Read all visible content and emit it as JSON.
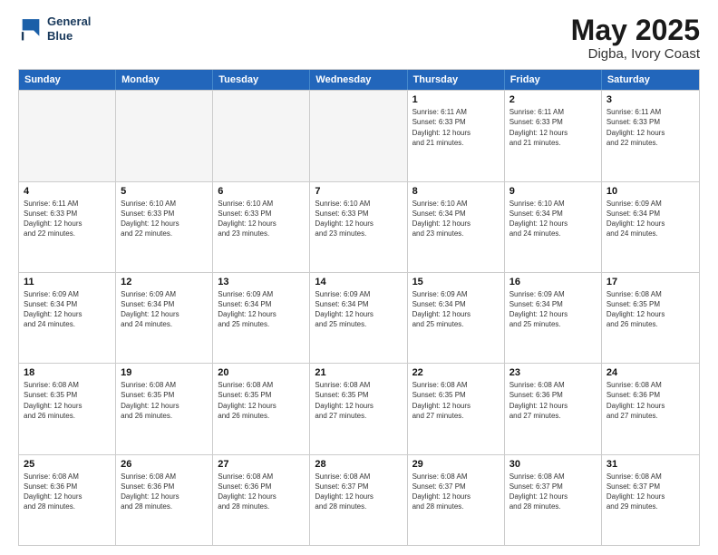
{
  "logo": {
    "line1": "General",
    "line2": "Blue"
  },
  "title": "May 2025",
  "location": "Digba, Ivory Coast",
  "days_of_week": [
    "Sunday",
    "Monday",
    "Tuesday",
    "Wednesday",
    "Thursday",
    "Friday",
    "Saturday"
  ],
  "weeks": [
    [
      {
        "day": "",
        "empty": true
      },
      {
        "day": "",
        "empty": true
      },
      {
        "day": "",
        "empty": true
      },
      {
        "day": "",
        "empty": true
      },
      {
        "day": "1",
        "info": "Sunrise: 6:11 AM\nSunset: 6:33 PM\nDaylight: 12 hours\nand 21 minutes."
      },
      {
        "day": "2",
        "info": "Sunrise: 6:11 AM\nSunset: 6:33 PM\nDaylight: 12 hours\nand 21 minutes."
      },
      {
        "day": "3",
        "info": "Sunrise: 6:11 AM\nSunset: 6:33 PM\nDaylight: 12 hours\nand 22 minutes."
      }
    ],
    [
      {
        "day": "4",
        "info": "Sunrise: 6:11 AM\nSunset: 6:33 PM\nDaylight: 12 hours\nand 22 minutes."
      },
      {
        "day": "5",
        "info": "Sunrise: 6:10 AM\nSunset: 6:33 PM\nDaylight: 12 hours\nand 22 minutes."
      },
      {
        "day": "6",
        "info": "Sunrise: 6:10 AM\nSunset: 6:33 PM\nDaylight: 12 hours\nand 23 minutes."
      },
      {
        "day": "7",
        "info": "Sunrise: 6:10 AM\nSunset: 6:33 PM\nDaylight: 12 hours\nand 23 minutes."
      },
      {
        "day": "8",
        "info": "Sunrise: 6:10 AM\nSunset: 6:34 PM\nDaylight: 12 hours\nand 23 minutes."
      },
      {
        "day": "9",
        "info": "Sunrise: 6:10 AM\nSunset: 6:34 PM\nDaylight: 12 hours\nand 24 minutes."
      },
      {
        "day": "10",
        "info": "Sunrise: 6:09 AM\nSunset: 6:34 PM\nDaylight: 12 hours\nand 24 minutes."
      }
    ],
    [
      {
        "day": "11",
        "info": "Sunrise: 6:09 AM\nSunset: 6:34 PM\nDaylight: 12 hours\nand 24 minutes."
      },
      {
        "day": "12",
        "info": "Sunrise: 6:09 AM\nSunset: 6:34 PM\nDaylight: 12 hours\nand 24 minutes."
      },
      {
        "day": "13",
        "info": "Sunrise: 6:09 AM\nSunset: 6:34 PM\nDaylight: 12 hours\nand 25 minutes."
      },
      {
        "day": "14",
        "info": "Sunrise: 6:09 AM\nSunset: 6:34 PM\nDaylight: 12 hours\nand 25 minutes."
      },
      {
        "day": "15",
        "info": "Sunrise: 6:09 AM\nSunset: 6:34 PM\nDaylight: 12 hours\nand 25 minutes."
      },
      {
        "day": "16",
        "info": "Sunrise: 6:09 AM\nSunset: 6:34 PM\nDaylight: 12 hours\nand 25 minutes."
      },
      {
        "day": "17",
        "info": "Sunrise: 6:08 AM\nSunset: 6:35 PM\nDaylight: 12 hours\nand 26 minutes."
      }
    ],
    [
      {
        "day": "18",
        "info": "Sunrise: 6:08 AM\nSunset: 6:35 PM\nDaylight: 12 hours\nand 26 minutes."
      },
      {
        "day": "19",
        "info": "Sunrise: 6:08 AM\nSunset: 6:35 PM\nDaylight: 12 hours\nand 26 minutes."
      },
      {
        "day": "20",
        "info": "Sunrise: 6:08 AM\nSunset: 6:35 PM\nDaylight: 12 hours\nand 26 minutes."
      },
      {
        "day": "21",
        "info": "Sunrise: 6:08 AM\nSunset: 6:35 PM\nDaylight: 12 hours\nand 27 minutes."
      },
      {
        "day": "22",
        "info": "Sunrise: 6:08 AM\nSunset: 6:35 PM\nDaylight: 12 hours\nand 27 minutes."
      },
      {
        "day": "23",
        "info": "Sunrise: 6:08 AM\nSunset: 6:36 PM\nDaylight: 12 hours\nand 27 minutes."
      },
      {
        "day": "24",
        "info": "Sunrise: 6:08 AM\nSunset: 6:36 PM\nDaylight: 12 hours\nand 27 minutes."
      }
    ],
    [
      {
        "day": "25",
        "info": "Sunrise: 6:08 AM\nSunset: 6:36 PM\nDaylight: 12 hours\nand 28 minutes."
      },
      {
        "day": "26",
        "info": "Sunrise: 6:08 AM\nSunset: 6:36 PM\nDaylight: 12 hours\nand 28 minutes."
      },
      {
        "day": "27",
        "info": "Sunrise: 6:08 AM\nSunset: 6:36 PM\nDaylight: 12 hours\nand 28 minutes."
      },
      {
        "day": "28",
        "info": "Sunrise: 6:08 AM\nSunset: 6:37 PM\nDaylight: 12 hours\nand 28 minutes."
      },
      {
        "day": "29",
        "info": "Sunrise: 6:08 AM\nSunset: 6:37 PM\nDaylight: 12 hours\nand 28 minutes."
      },
      {
        "day": "30",
        "info": "Sunrise: 6:08 AM\nSunset: 6:37 PM\nDaylight: 12 hours\nand 28 minutes."
      },
      {
        "day": "31",
        "info": "Sunrise: 6:08 AM\nSunset: 6:37 PM\nDaylight: 12 hours\nand 29 minutes."
      }
    ]
  ],
  "colors": {
    "header_bg": "#2266bb",
    "shaded": "#f0f0f0"
  }
}
